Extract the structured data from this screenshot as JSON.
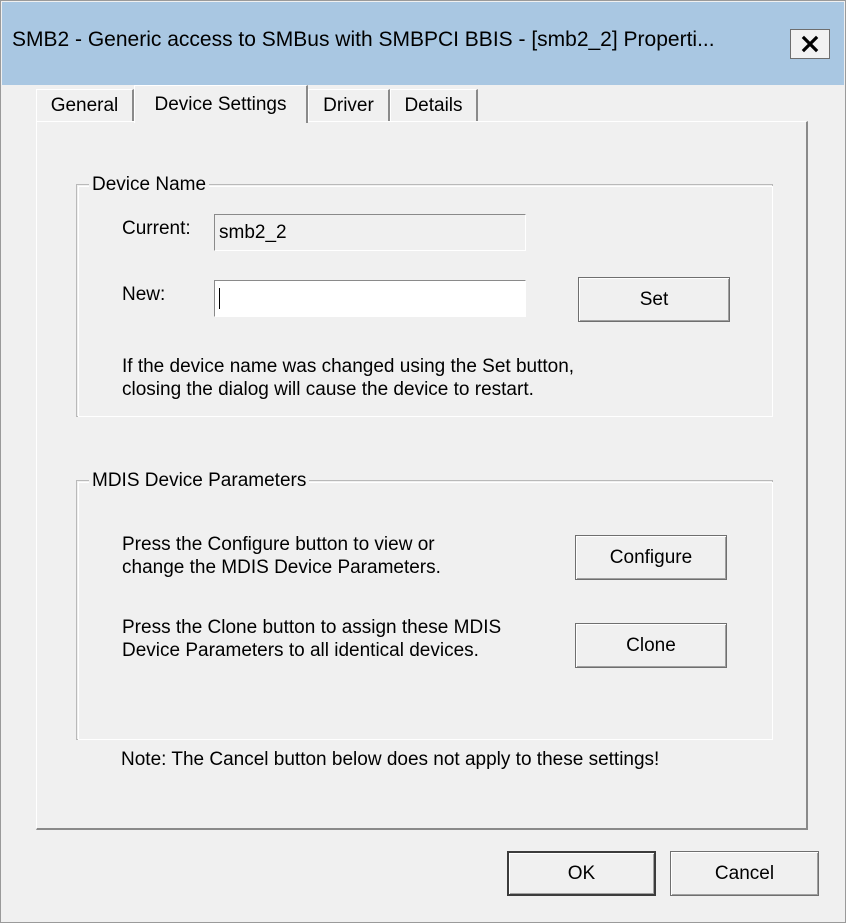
{
  "window": {
    "title": "SMB2 - Generic access to SMBus with SMBPCI BBIS - [smb2_2] Properti...",
    "close_icon": "close-icon"
  },
  "tabs": [
    {
      "label": "General",
      "active": false
    },
    {
      "label": "Device Settings",
      "active": true
    },
    {
      "label": "Driver",
      "active": false
    },
    {
      "label": "Details",
      "active": false
    }
  ],
  "device_name": {
    "legend": "Device Name",
    "current_label": "Current:",
    "current_value": "smb2_2",
    "new_label": "New:",
    "new_value": "",
    "set_button": "Set",
    "note_line1": "If the device name was changed using the Set button,",
    "note_line2": "closing the dialog will cause the device to restart."
  },
  "mdis": {
    "legend": "MDIS Device Parameters",
    "configure_text_line1": "Press the Configure button to view or",
    "configure_text_line2": "change the MDIS Device Parameters.",
    "configure_button": "Configure",
    "clone_text_line1": "Press the Clone button to assign these MDIS",
    "clone_text_line2": "Device Parameters to all identical devices.",
    "clone_button": "Clone"
  },
  "note": "Note: The Cancel button below does not apply to these settings!",
  "footer": {
    "ok_button": "OK",
    "cancel_button": "Cancel"
  }
}
